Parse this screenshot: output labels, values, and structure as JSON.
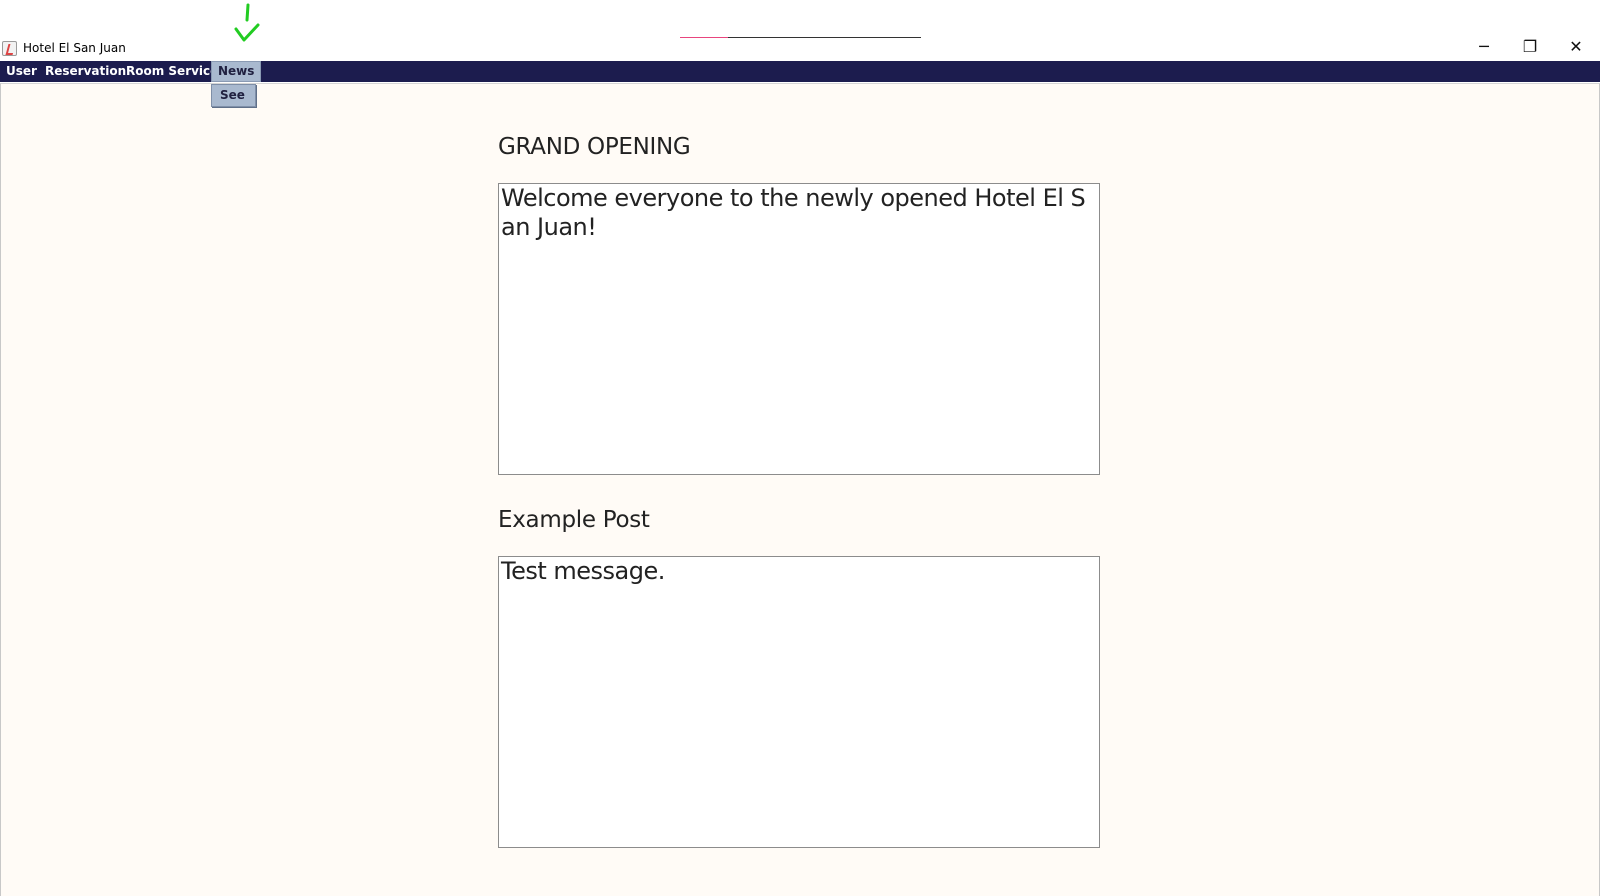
{
  "window": {
    "title": "Hotel El San Juan",
    "controls": {
      "minimize": "─",
      "maximize": "❐",
      "close": "✕"
    },
    "title_progress_fraction": 0.2
  },
  "menubar": {
    "items": [
      {
        "label": "User"
      },
      {
        "label": "Reservation"
      },
      {
        "label": "Room Service"
      },
      {
        "label": "News"
      }
    ]
  },
  "dropdown": {
    "items": [
      {
        "label": "See"
      }
    ]
  },
  "posts": [
    {
      "title": "GRAND OPENING",
      "message": "Welcome everyone to the newly opened Hotel El San Juan!"
    },
    {
      "title": "Example Post",
      "message": "Test message."
    }
  ],
  "colors": {
    "menubar_bg": "#1c1c4e",
    "menu_highlight": "#a9b9cf",
    "content_bg": "#fffbf6",
    "check_mark": "#22cc22"
  }
}
